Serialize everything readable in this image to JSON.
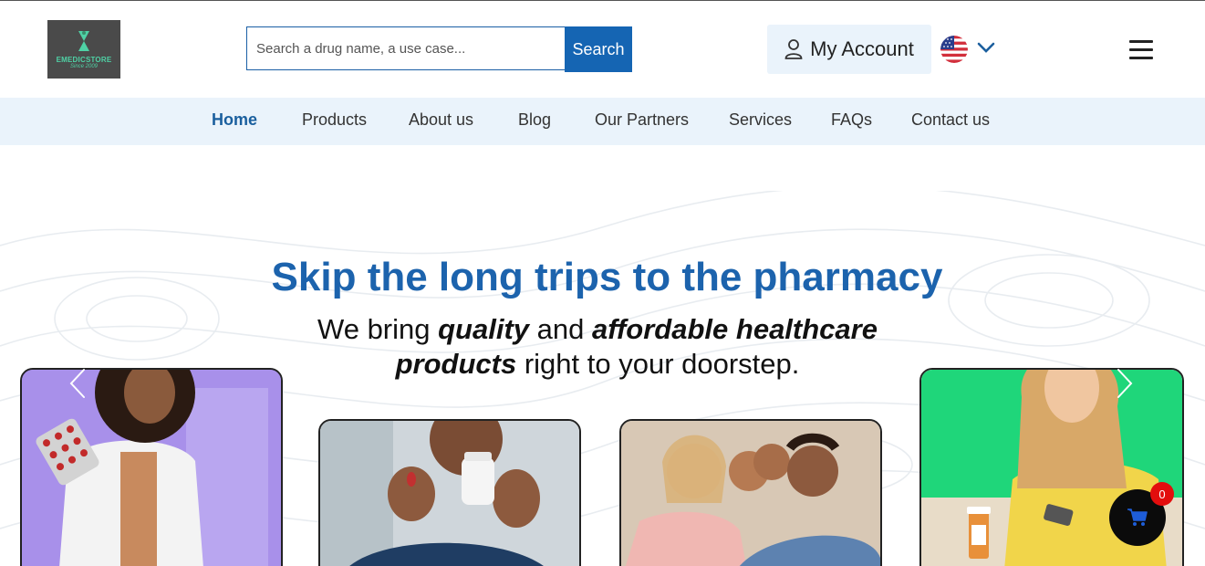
{
  "logo": {
    "name": "EMEDICSTORE",
    "since": "Since 2009"
  },
  "search": {
    "placeholder": "Search a drug name, a use case...",
    "button_label": "Search"
  },
  "account": {
    "label": "My Account",
    "language_icon": "us-flag-icon"
  },
  "nav": {
    "items": [
      {
        "label": "Home",
        "active": true
      },
      {
        "label": "Products",
        "active": false
      },
      {
        "label": "About us",
        "active": false
      },
      {
        "label": "Blog",
        "active": false
      },
      {
        "label": "Our Partners",
        "active": false
      },
      {
        "label": "Services",
        "active": false
      },
      {
        "label": "FAQs",
        "active": false
      },
      {
        "label": "Contact us",
        "active": false
      }
    ]
  },
  "hero": {
    "headline": "Skip the long trips to the pharmacy",
    "sub_1": "We bring ",
    "sub_2": "quality",
    "sub_3": " and ",
    "sub_4": "affordable healthcare",
    "sub_5": "products",
    "sub_6": " right to your doorstep."
  },
  "cart": {
    "count": "0"
  },
  "colors": {
    "brand_blue": "#1c63ad",
    "nav_bg": "#eaf3fb",
    "badge_red": "#e30d0d"
  }
}
